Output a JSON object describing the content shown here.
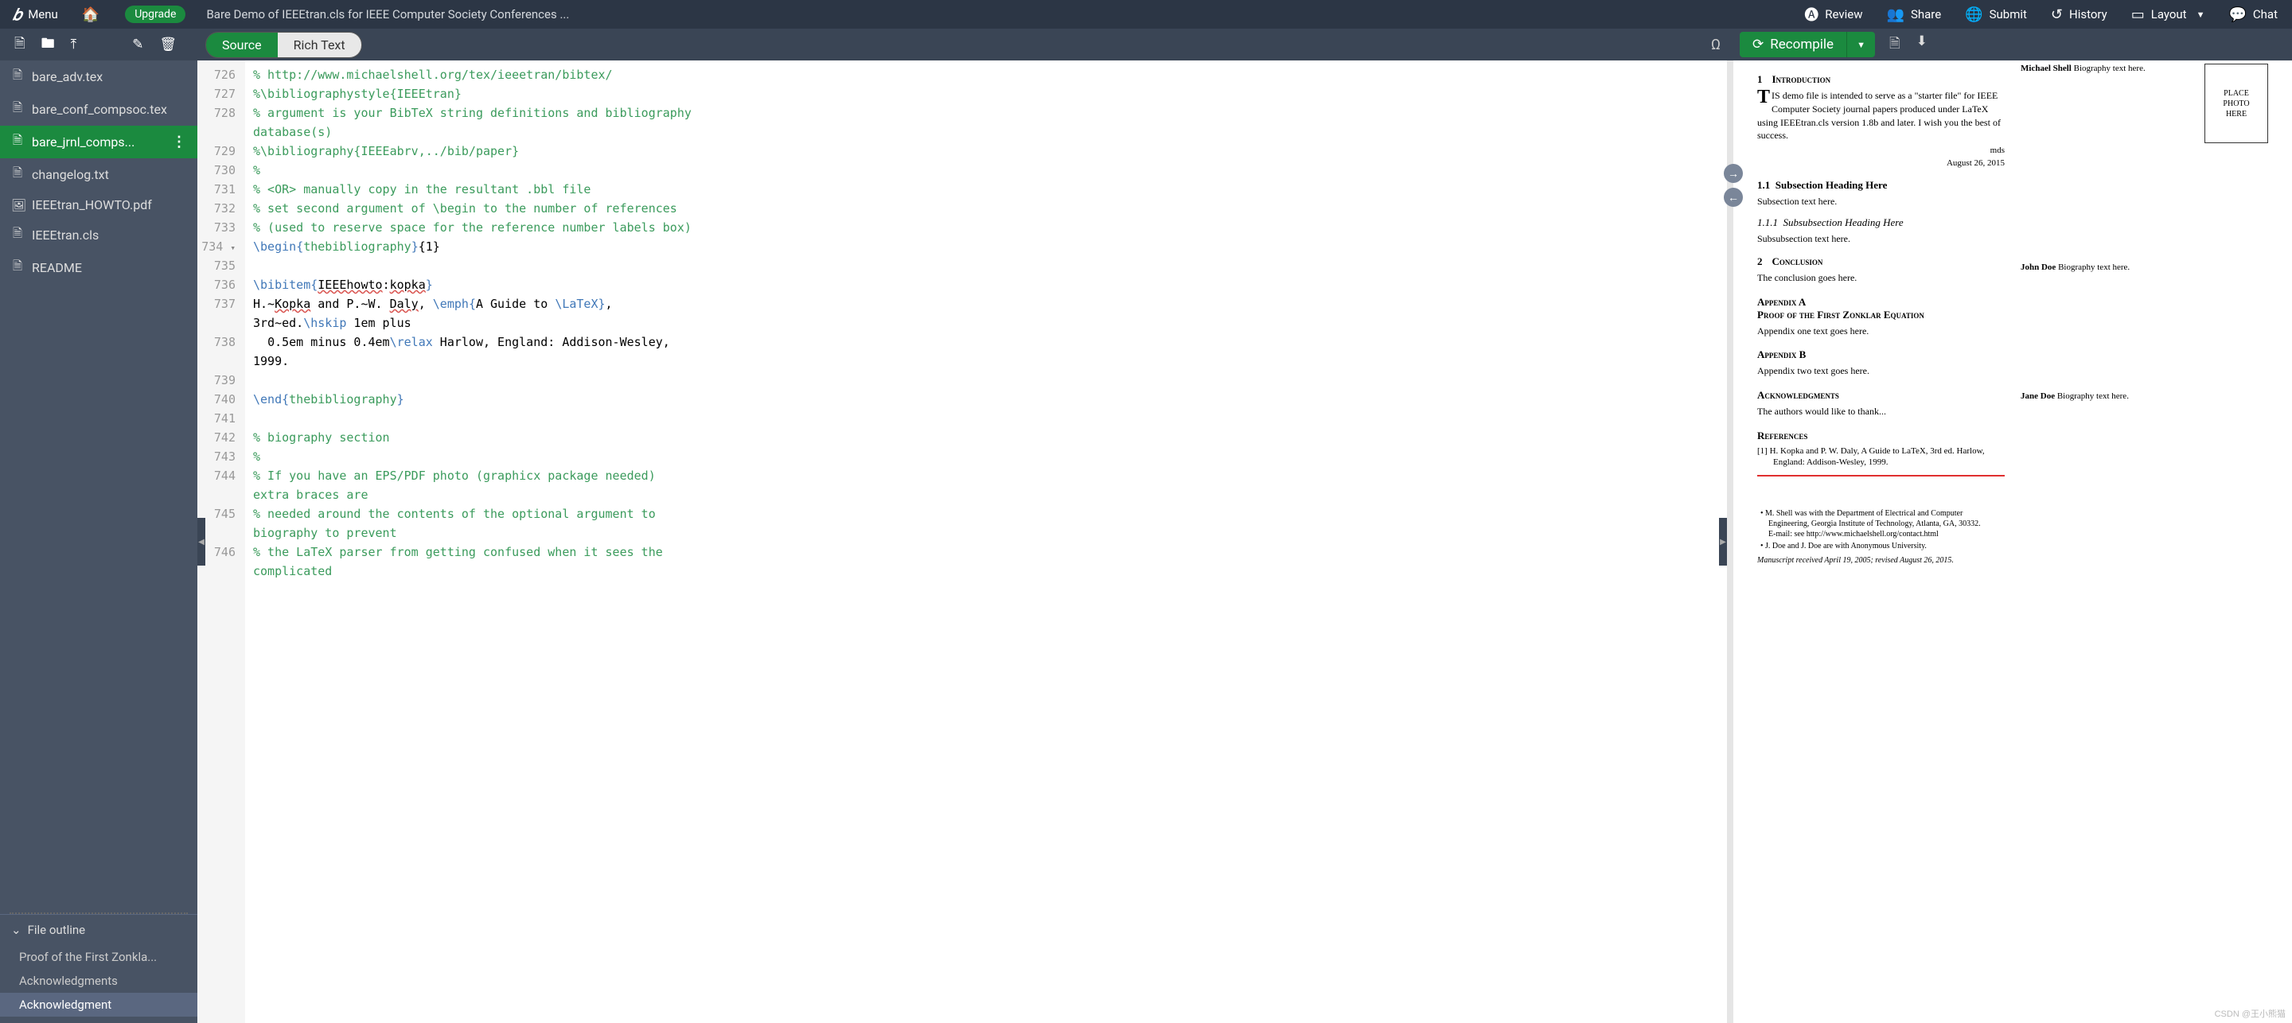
{
  "topbar": {
    "menu": "Menu",
    "upgrade": "Upgrade",
    "project_title": "Bare Demo of IEEEtran.cls for IEEE Computer Society Conferences ...",
    "review": "Review",
    "share": "Share",
    "submit": "Submit",
    "history": "History",
    "layout": "Layout",
    "chat": "Chat"
  },
  "toggle": {
    "source": "Source",
    "richtext": "Rich Text"
  },
  "recompile": {
    "label": "Recompile"
  },
  "files": [
    {
      "icon": "doc",
      "name": "bare_adv.tex"
    },
    {
      "icon": "doc",
      "name": "bare_conf_compsoc.tex"
    },
    {
      "icon": "doc",
      "name": "bare_jrnl_comps...",
      "active": true,
      "more": true
    },
    {
      "icon": "doc",
      "name": "changelog.txt"
    },
    {
      "icon": "img",
      "name": "IEEEtran_HOWTO.pdf"
    },
    {
      "icon": "doc",
      "name": "IEEEtran.cls"
    },
    {
      "icon": "doc",
      "name": "README"
    }
  ],
  "outline": {
    "header": "File outline",
    "items": [
      {
        "text": "Proof of the First Zonkla..."
      },
      {
        "text": "Acknowledgments"
      },
      {
        "text": "Acknowledgment",
        "active": true
      }
    ]
  },
  "gutter": [
    "726",
    "727",
    "728",
    "",
    "729",
    "730",
    "731",
    "732",
    "733",
    "734",
    "735",
    "736",
    "737",
    "",
    "738",
    "",
    "739",
    "740",
    "741",
    "742",
    "743",
    "744",
    "",
    "745",
    "",
    "746",
    ""
  ],
  "fold_line": "734",
  "code": [
    {
      "t": "comment",
      "v": "% http://www.michaelshell.org/tex/ieeetran/bibtex/"
    },
    {
      "t": "comment",
      "v": "%\\bibliographystyle{IEEEtran}"
    },
    {
      "t": "comment",
      "v": "% argument is your BibTeX string definitions and bibliography"
    },
    {
      "t": "comment",
      "v": "database(s)"
    },
    {
      "t": "comment",
      "v": "%\\bibliography{IEEEabrv,../bib/paper}"
    },
    {
      "t": "comment",
      "v": "%"
    },
    {
      "t": "comment",
      "v": "% <OR> manually copy in the resultant .bbl file"
    },
    {
      "t": "comment",
      "v": "% set second argument of \\begin to the number of references"
    },
    {
      "t": "comment",
      "v": "% (used to reserve space for the reference number labels box)"
    },
    {
      "t": "begin",
      "cmd": "\\begin",
      "arg": "{thebibliography}",
      "rest": "{1}"
    },
    {
      "t": "blank",
      "v": ""
    },
    {
      "t": "bibitem",
      "cmd": "\\bibitem",
      "arg": "{IEEEhowto:kopka}"
    },
    {
      "t": "mixed",
      "v": "H.~Kopka and P.~W. Daly, \\emph{A Guide to \\LaTeX}, "
    },
    {
      "t": "plain",
      "v": "3rd~ed.\\hskip 1em plus"
    },
    {
      "t": "mixed2",
      "v": "  0.5em minus 0.4em\\relax Harlow, England: Addison-Wesley, "
    },
    {
      "t": "plain",
      "v": "1999."
    },
    {
      "t": "blank",
      "v": ""
    },
    {
      "t": "end",
      "cmd": "\\end",
      "arg": "{thebibliography}"
    },
    {
      "t": "blank",
      "v": ""
    },
    {
      "t": "comment",
      "v": "% biography section"
    },
    {
      "t": "comment",
      "v": "%"
    },
    {
      "t": "comment",
      "v": "% If you have an EPS/PDF photo (graphicx package needed) "
    },
    {
      "t": "comment",
      "v": "extra braces are"
    },
    {
      "t": "comment",
      "v": "% needed around the contents of the optional argument to "
    },
    {
      "t": "comment",
      "v": "biography to prevent"
    },
    {
      "t": "comment",
      "v": "% the LaTeX parser from getting confused when it sees the "
    },
    {
      "t": "comment",
      "v": "complicated"
    }
  ],
  "preview": {
    "sec1_num": "1",
    "sec1_name": "Introduction",
    "intro": "HIS demo file is intended to serve as a \"starter file\" for IEEE Computer Society journal papers produced under LaTeX using IEEEtran.cls version 1.8b and later. I wish you the best of success.",
    "author_short": "mds",
    "date": "August 26, 2015",
    "subsec": "1.1",
    "subsec_name": "Subsection Heading Here",
    "subsec_text": "Subsection text here.",
    "subsubsec": "1.1.1",
    "subsubsec_name": "Subsubsection Heading Here",
    "subsubsec_text": "Subsubsection text here.",
    "sec2_num": "2",
    "sec2_name": "Conclusion",
    "sec2_text": "The conclusion goes here.",
    "appA": "Appendix A",
    "appA_title": "Proof of the First Zonklar Equation",
    "appA_text": "Appendix one text goes here.",
    "appB": "Appendix B",
    "appB_text": "Appendix two text goes here.",
    "ack": "Acknowledgments",
    "ack_text": "The authors would like to thank...",
    "refs": "References",
    "ref1": "[1]  H. Kopka and P. W. Daly, A Guide to LaTeX, 3rd ed.  Harlow, England: Addison-Wesley, 1999.",
    "foot1": "•   M. Shell was with the Department of Electrical and Computer Engineering, Georgia Institute of Technology, Atlanta, GA, 30332.\nE-mail: see http://www.michaelshell.org/contact.html",
    "foot2": "•   J. Doe and J. Doe are with Anonymous University.",
    "manuscript": "Manuscript received April 19, 2005; revised August 26, 2015.",
    "photo": "PLACE\nPHOTO\nHERE",
    "bio1_name": "Michael Shell",
    "bio1_text": " Biography text here.",
    "bio2_name": "John Doe",
    "bio2_text": " Biography text here.",
    "bio3_name": "Jane Doe",
    "bio3_text": " Biography text here."
  },
  "watermark": "CSDN @王小熊猫"
}
